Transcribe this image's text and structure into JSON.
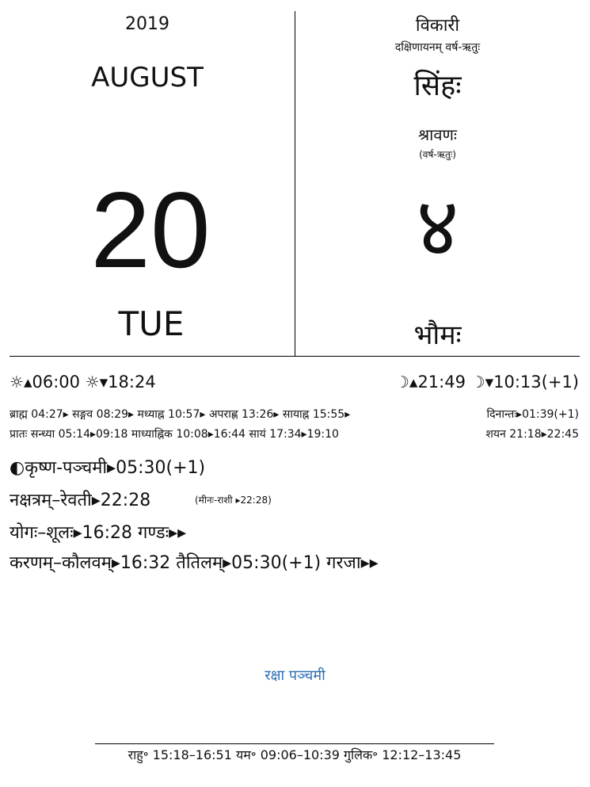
{
  "left": {
    "year": "2019",
    "month": "AUGUST",
    "day": "20",
    "weekday": "TUE"
  },
  "right": {
    "samvatsara": "विकारी",
    "ayana_ritu": "दक्षिणायनम्   वर्ष-ऋतुः",
    "rashi": "सिंहः",
    "masa": "श्रावणः",
    "masa_ritu": "(वर्ष-ऋतुः)",
    "tithi_num": "४",
    "vara": "भौमः"
  },
  "sun": {
    "icon": "sun-icon",
    "rise": "▴06:00",
    "set": "▾18:24"
  },
  "moon": {
    "icon": "moon-icon",
    "rise": "▴21:49",
    "set": "▾10:13(+1)"
  },
  "kala": {
    "line1": "ब्राह्म 04:27▸ सङ्गव 08:29▸ मध्याह्न 10:57▸ अपराह्ण 13:26▸ सायाह्न 15:55▸",
    "dinanta": "दिनान्तः▸01:39(+1)",
    "line2": "प्रातः सन्ध्या 05:14▸09:18 माध्याह्निक 10:08▸16:44 सायं 17:34▸19:10",
    "shayana": "शयन 21:18▸22:45"
  },
  "tithi": "कृष्ण-पञ्चमी▸05:30(+1)",
  "nakshatra": "नक्षत्रम्–रेवती▸22:28",
  "nakshatra_rashi": "(मीनः-राशी ▸22:28)",
  "yoga": "योगः–शूलः▸16:28  गण्डः▸▸",
  "karana": "करणम्–कौलवम्▸16:32  तैतिलम्▸05:30(+1)  गरजा▸▸",
  "festival": "रक्षा पञ्चमी",
  "footer": "राहु॰ 15:18–16:51   यम॰ 09:06–10:39   गुलिक॰ 12:12–13:45"
}
